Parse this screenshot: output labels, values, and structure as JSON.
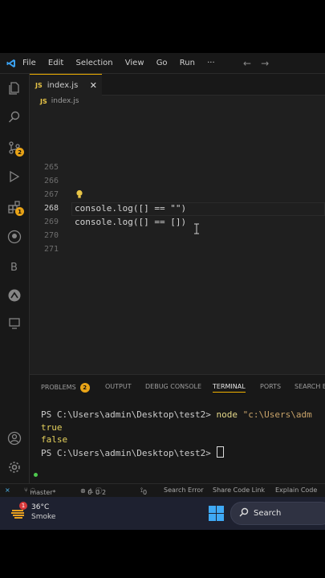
{
  "menu": [
    "File",
    "Edit",
    "Selection",
    "View",
    "Go",
    "Run",
    "···"
  ],
  "activity": {
    "scm_badge": "2",
    "ext_badge": "1"
  },
  "tab": {
    "badge": "JS",
    "name": "index.js",
    "close": "✕"
  },
  "breadcrumb": {
    "badge": "JS",
    "file": "index.js"
  },
  "editor": {
    "lines": [
      {
        "num": "265",
        "code": ""
      },
      {
        "num": "266",
        "code": ""
      },
      {
        "num": "267",
        "code": ""
      },
      {
        "num": "268",
        "code": "console.log([] == \"\")"
      },
      {
        "num": "269",
        "code": "console.log([] == [])"
      },
      {
        "num": "270",
        "code": ""
      },
      {
        "num": "271",
        "code": ""
      }
    ],
    "current_line": 268
  },
  "panel": {
    "tabs": [
      "PROBLEMS",
      "OUTPUT",
      "DEBUG CONSOLE",
      "TERMINAL",
      "PORTS",
      "SEARCH E"
    ],
    "problems_count": "2",
    "active_tab": "TERMINAL",
    "terminal": {
      "prompt1": "PS C:\\Users\\admin\\Desktop\\test2> ",
      "cmd": "node",
      "arg": " \"c:\\Users\\adm",
      "out1": "true",
      "out2": "false",
      "prompt2": "PS C:\\Users\\admin\\Desktop\\test2> "
    }
  },
  "status": {
    "branch": "master*",
    "errors": "0",
    "warnings": "0",
    "info": "2",
    "ports": "0",
    "search_error": "Search Error",
    "share": "Share Code Link",
    "explain": "Explain Code"
  },
  "taskbar": {
    "temp": "36°C",
    "weather": "Smoke",
    "notif": "1",
    "search": "Search"
  },
  "colors": {
    "accent": "#f0b000",
    "badge": "#e8a317",
    "bg": "#1f1f1f",
    "sidebar": "#181818"
  }
}
